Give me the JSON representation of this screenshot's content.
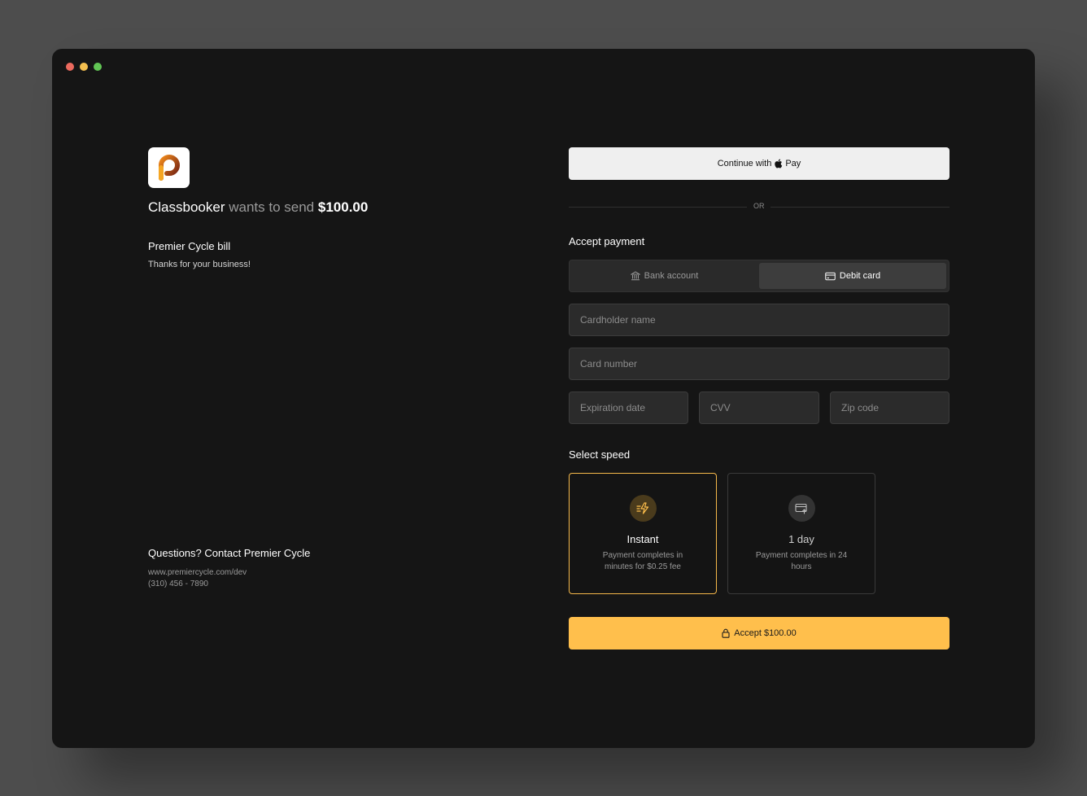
{
  "merchant": {
    "name": "Classbooker",
    "wants_text": "wants to send",
    "amount": "$100.00"
  },
  "bill": {
    "title": "Premier Cycle bill",
    "note": "Thanks for your business!"
  },
  "contact": {
    "title": "Questions? Contact Premier Cycle",
    "website": "www.premiercycle.com/dev",
    "phone": "(310) 456 - 7890"
  },
  "apple_pay": {
    "prefix": "Continue with",
    "suffix": "Pay"
  },
  "divider_text": "OR",
  "accept_payment": {
    "title": "Accept payment",
    "tabs": [
      {
        "label": "Bank account",
        "icon": "bank-icon",
        "selected": false
      },
      {
        "label": "Debit card",
        "icon": "card-icon",
        "selected": true
      }
    ]
  },
  "fields": {
    "cardholder": {
      "placeholder": "Cardholder name",
      "value": ""
    },
    "card_number": {
      "placeholder": "Card number",
      "value": ""
    },
    "expiration": {
      "placeholder": "Expiration date",
      "value": ""
    },
    "cvv": {
      "placeholder": "CVV",
      "value": ""
    },
    "zip": {
      "placeholder": "Zip code",
      "value": ""
    }
  },
  "speed": {
    "title": "Select speed",
    "options": [
      {
        "title": "Instant",
        "desc": "Payment completes in minutes for $0.25 fee",
        "icon": "lightning-icon",
        "selected": true
      },
      {
        "title": "1 day",
        "desc": "Payment completes in 24 hours",
        "icon": "card-transfer-icon",
        "selected": false
      }
    ]
  },
  "accept_button": {
    "label": "Accept $100.00",
    "icon": "lock-icon"
  },
  "colors": {
    "accent": "#ffbf4c",
    "window_bg": "#151515",
    "backdrop": "#4d4d4d"
  }
}
